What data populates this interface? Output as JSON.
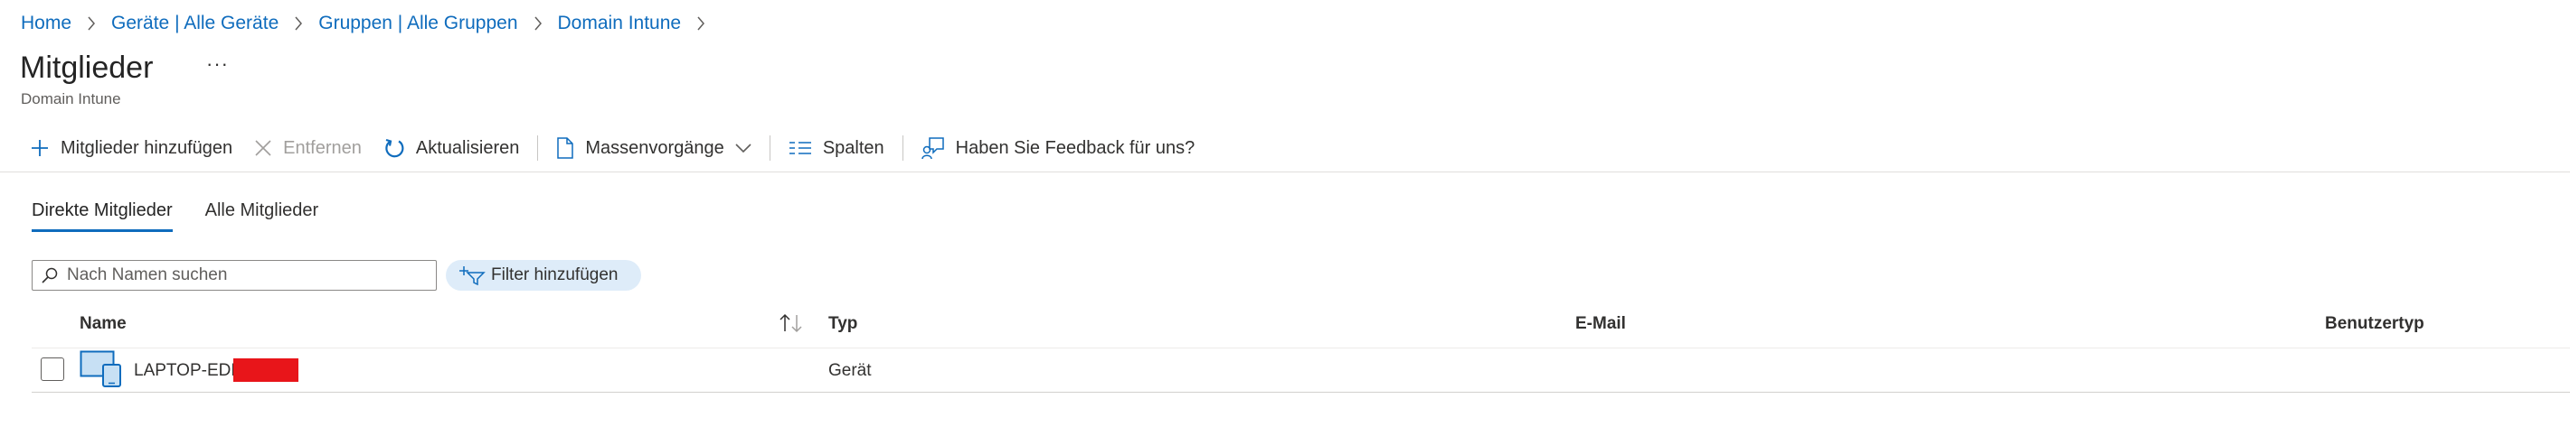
{
  "breadcrumb": [
    "Home",
    "Geräte | Alle Geräte",
    "Gruppen | Alle Gruppen",
    "Domain Intune"
  ],
  "page": {
    "title": "Mitglieder",
    "more": "···",
    "subtitle": "Domain Intune"
  },
  "toolbar": {
    "add": "Mitglieder hinzufügen",
    "remove": "Entfernen",
    "refresh": "Aktualisieren",
    "bulk": "Massenvorgänge",
    "columns": "Spalten",
    "feedback": "Haben Sie Feedback für uns?"
  },
  "tabs": [
    "Direkte Mitglieder",
    "Alle Mitglieder"
  ],
  "search": {
    "placeholder": "Nach Namen suchen"
  },
  "filter": {
    "label": "Filter hinzufügen"
  },
  "table": {
    "columns": [
      "Name",
      "Typ",
      "E-Mail",
      "Benutzertyp"
    ],
    "rows": [
      {
        "name": "LAPTOP-EDL",
        "type": "Gerät",
        "email": "",
        "user_type": ""
      }
    ]
  },
  "colors": {
    "accent": "#0f6cbd",
    "redaction": "#e8151a",
    "filter_bg": "#deecf9"
  },
  "icons": [
    "chevron-right-icon",
    "more-icon",
    "add-icon",
    "close-icon",
    "refresh-icon",
    "document-icon",
    "chevron-down-icon",
    "columns-icon",
    "feedback-icon",
    "search-icon",
    "filter-add-icon",
    "sort-icon",
    "device-icon"
  ]
}
